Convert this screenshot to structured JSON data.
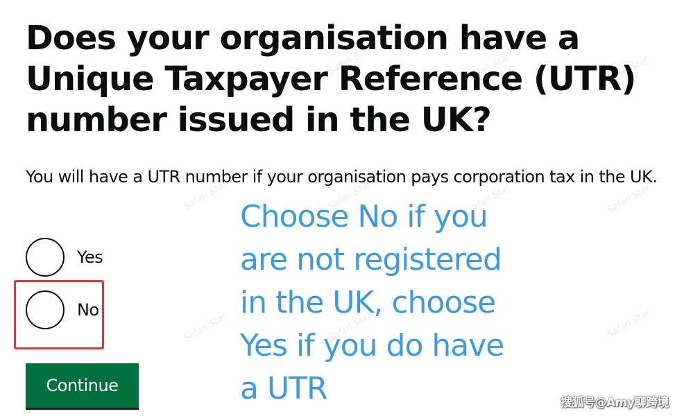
{
  "question": {
    "heading": "Does your organisation have a Unique Taxpayer Reference (UTR) number issued in the UK?",
    "hint": "You will have a UTR number if your organisation pays corporation tax in the UK."
  },
  "options": {
    "yes_label": "Yes",
    "no_label": "No"
  },
  "actions": {
    "continue_label": "Continue"
  },
  "annotation": {
    "lines": [
      "Choose No if you",
      "are not registered",
      "in the UK, choose",
      "Yes if you do have",
      "a UTR"
    ],
    "color": "#3a9be0",
    "highlight_color": "#e03535"
  },
  "watermarks": {
    "tile_text": "Safari Star",
    "footer_text": "搜狐号@Amy聊跨境"
  },
  "colors": {
    "button_green": "#00703c",
    "text": "#0b0c0c"
  }
}
